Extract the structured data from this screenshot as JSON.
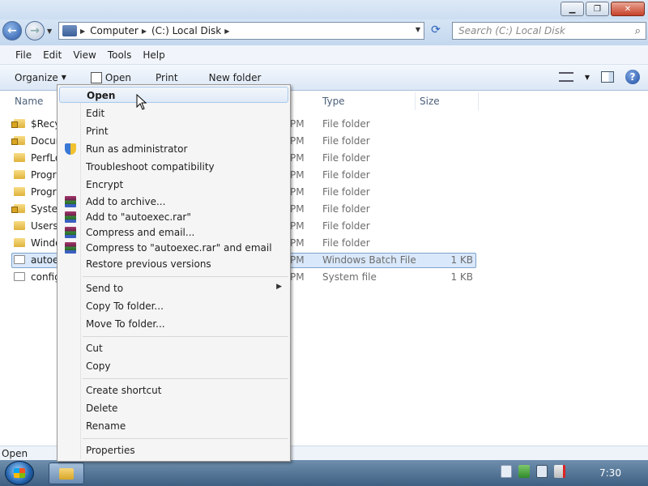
{
  "window": {
    "minimize_glyph": "▁",
    "maximize_glyph": "❐",
    "close_glyph": "✕"
  },
  "address": {
    "crumbs": [
      "Computer",
      "(C:) Local Disk"
    ],
    "search_placeholder": "Search (C:) Local Disk"
  },
  "menubar": [
    "File",
    "Edit",
    "View",
    "Tools",
    "Help"
  ],
  "toolbar": {
    "organize": "Organize",
    "open": "Open",
    "print": "Print",
    "new_folder": "New folder"
  },
  "columns": {
    "name": "Name",
    "type": "Type",
    "size": "Size"
  },
  "files": [
    {
      "name": "$Recy",
      "date": "PM",
      "type": "File folder",
      "size": "",
      "icon": "locked-folder-icon"
    },
    {
      "name": "Docun",
      "date": "PM",
      "type": "File folder",
      "size": "",
      "icon": "locked-folder-icon"
    },
    {
      "name": "PerfLo",
      "date": "PM",
      "type": "File folder",
      "size": "",
      "icon": "folder-icon"
    },
    {
      "name": "Progra",
      "date": "PM",
      "type": "File folder",
      "size": "",
      "icon": "folder-icon"
    },
    {
      "name": "Progra",
      "date": "PM",
      "type": "File folder",
      "size": "",
      "icon": "folder-icon"
    },
    {
      "name": "Systen",
      "date": "PM",
      "type": "File folder",
      "size": "",
      "icon": "locked-folder-icon"
    },
    {
      "name": "Users",
      "date": "PM",
      "type": "File folder",
      "size": "",
      "icon": "folder-icon"
    },
    {
      "name": "Windo",
      "date": "PM",
      "type": "File folder",
      "size": "",
      "icon": "folder-icon"
    },
    {
      "name": "autoex",
      "date": "PM",
      "type": "Windows Batch File",
      "size": "1 KB",
      "icon": "batch-file-icon",
      "selected": true
    },
    {
      "name": "config",
      "date": "PM",
      "type": "System file",
      "size": "1 KB",
      "icon": "system-file-icon"
    }
  ],
  "context_menu": {
    "items": [
      {
        "label": "Open",
        "bold": true,
        "hover": true
      },
      {
        "label": "Edit"
      },
      {
        "label": "Print"
      },
      {
        "label": "Run as administrator",
        "icon": "shield-icon"
      },
      {
        "label": "Troubleshoot compatibility"
      },
      {
        "label": "Encrypt"
      },
      {
        "label": "Add to archive...",
        "icon": "winrar-icon"
      },
      {
        "label": "Add to \"autoexec.rar\"",
        "icon": "winrar-icon"
      },
      {
        "label": "Compress and email...",
        "icon": "winrar-icon"
      },
      {
        "label": "Compress to \"autoexec.rar\" and email",
        "icon": "winrar-icon"
      },
      {
        "label": "Restore previous versions"
      },
      {
        "label": "Send to",
        "submenu": true
      },
      {
        "label": "Copy To folder..."
      },
      {
        "label": "Move To folder..."
      },
      {
        "label": "Cut"
      },
      {
        "label": "Copy"
      },
      {
        "label": "Create shortcut"
      },
      {
        "label": "Delete"
      },
      {
        "label": "Rename"
      },
      {
        "label": "Properties"
      }
    ]
  },
  "status": {
    "text": "Open"
  },
  "taskbar": {
    "clock": "7:30"
  }
}
